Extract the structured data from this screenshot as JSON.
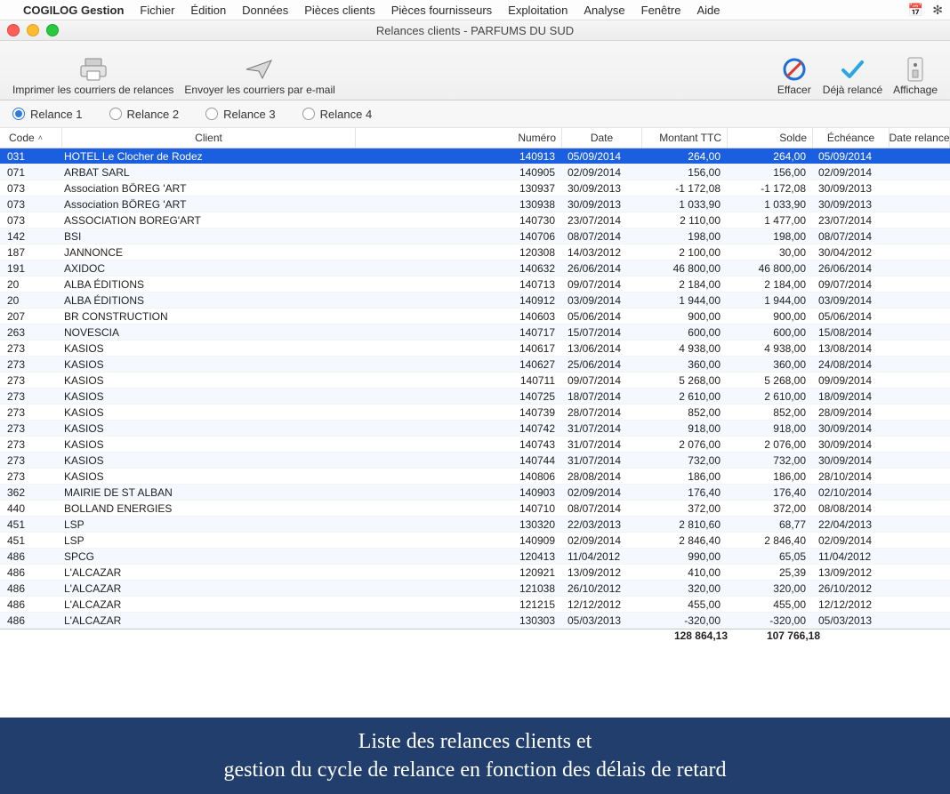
{
  "menubar": {
    "appname": "COGILOG Gestion",
    "items": [
      "Fichier",
      "Édition",
      "Données",
      "Pièces clients",
      "Pièces fournisseurs",
      "Exploitation",
      "Analyse",
      "Fenêtre",
      "Aide"
    ]
  },
  "window": {
    "title": "Relances clients - PARFUMS DU SUD"
  },
  "toolbar": {
    "print": "Imprimer les courriers de relances",
    "email": "Envoyer les courriers par e-mail",
    "clear": "Effacer",
    "done": "Déjà relancé",
    "display": "Affichage"
  },
  "radios": {
    "r1": "Relance 1",
    "r2": "Relance 2",
    "r3": "Relance 3",
    "r4": "Relance 4",
    "selected": 0
  },
  "columns": {
    "code": "Code",
    "client": "Client",
    "numero": "Numéro",
    "date": "Date",
    "montant": "Montant TTC",
    "solde": "Solde",
    "echeance": "Échéance",
    "daterelance": "Date relance"
  },
  "rows": [
    {
      "code": "031",
      "client": "HOTEL Le Clocher de Rodez",
      "num": "140913",
      "date": "05/09/2014",
      "mont": "264,00",
      "sold": "264,00",
      "ech": "05/09/2014",
      "sel": true
    },
    {
      "code": "071",
      "client": "ARBAT SARL",
      "num": "140905",
      "date": "02/09/2014",
      "mont": "156,00",
      "sold": "156,00",
      "ech": "02/09/2014"
    },
    {
      "code": "073",
      "client": "Association BÖREG 'ART",
      "num": "130937",
      "date": "30/09/2013",
      "mont": "-1 172,08",
      "sold": "-1 172,08",
      "ech": "30/09/2013"
    },
    {
      "code": "073",
      "client": "Association BÖREG 'ART",
      "num": "130938",
      "date": "30/09/2013",
      "mont": "1 033,90",
      "sold": "1 033,90",
      "ech": "30/09/2013"
    },
    {
      "code": "073",
      "client": "ASSOCIATION BOREG'ART",
      "num": "140730",
      "date": "23/07/2014",
      "mont": "2 110,00",
      "sold": "1 477,00",
      "ech": "23/07/2014"
    },
    {
      "code": "142",
      "client": "BSI",
      "num": "140706",
      "date": "08/07/2014",
      "mont": "198,00",
      "sold": "198,00",
      "ech": "08/07/2014"
    },
    {
      "code": "187",
      "client": "JANNONCE",
      "num": "120308",
      "date": "14/03/2012",
      "mont": "2 100,00",
      "sold": "30,00",
      "ech": "30/04/2012"
    },
    {
      "code": "191",
      "client": "AXIDOC",
      "num": "140632",
      "date": "26/06/2014",
      "mont": "46 800,00",
      "sold": "46 800,00",
      "ech": "26/06/2014"
    },
    {
      "code": "20",
      "client": "ALBA ÉDITIONS",
      "num": "140713",
      "date": "09/07/2014",
      "mont": "2 184,00",
      "sold": "2 184,00",
      "ech": "09/07/2014"
    },
    {
      "code": "20",
      "client": "ALBA ÉDITIONS",
      "num": "140912",
      "date": "03/09/2014",
      "mont": "1 944,00",
      "sold": "1 944,00",
      "ech": "03/09/2014"
    },
    {
      "code": "207",
      "client": "BR CONSTRUCTION",
      "num": "140603",
      "date": "05/06/2014",
      "mont": "900,00",
      "sold": "900,00",
      "ech": "05/06/2014"
    },
    {
      "code": "263",
      "client": "NOVESCIA",
      "num": "140717",
      "date": "15/07/2014",
      "mont": "600,00",
      "sold": "600,00",
      "ech": "15/08/2014"
    },
    {
      "code": "273",
      "client": "KASIOS",
      "num": "140617",
      "date": "13/06/2014",
      "mont": "4 938,00",
      "sold": "4 938,00",
      "ech": "13/08/2014"
    },
    {
      "code": "273",
      "client": "KASIOS",
      "num": "140627",
      "date": "25/06/2014",
      "mont": "360,00",
      "sold": "360,00",
      "ech": "24/08/2014"
    },
    {
      "code": "273",
      "client": "KASIOS",
      "num": "140711",
      "date": "09/07/2014",
      "mont": "5 268,00",
      "sold": "5 268,00",
      "ech": "09/09/2014"
    },
    {
      "code": "273",
      "client": "KASIOS",
      "num": "140725",
      "date": "18/07/2014",
      "mont": "2 610,00",
      "sold": "2 610,00",
      "ech": "18/09/2014"
    },
    {
      "code": "273",
      "client": "KASIOS",
      "num": "140739",
      "date": "28/07/2014",
      "mont": "852,00",
      "sold": "852,00",
      "ech": "28/09/2014"
    },
    {
      "code": "273",
      "client": "KASIOS",
      "num": "140742",
      "date": "31/07/2014",
      "mont": "918,00",
      "sold": "918,00",
      "ech": "30/09/2014"
    },
    {
      "code": "273",
      "client": "KASIOS",
      "num": "140743",
      "date": "31/07/2014",
      "mont": "2 076,00",
      "sold": "2 076,00",
      "ech": "30/09/2014"
    },
    {
      "code": "273",
      "client": "KASIOS",
      "num": "140744",
      "date": "31/07/2014",
      "mont": "732,00",
      "sold": "732,00",
      "ech": "30/09/2014"
    },
    {
      "code": "273",
      "client": "KASIOS",
      "num": "140806",
      "date": "28/08/2014",
      "mont": "186,00",
      "sold": "186,00",
      "ech": "28/10/2014"
    },
    {
      "code": "362",
      "client": "MAIRIE  DE ST ALBAN",
      "num": "140903",
      "date": "02/09/2014",
      "mont": "176,40",
      "sold": "176,40",
      "ech": "02/10/2014"
    },
    {
      "code": "440",
      "client": "BOLLAND ENERGIES",
      "num": "140710",
      "date": "08/07/2014",
      "mont": "372,00",
      "sold": "372,00",
      "ech": "08/08/2014"
    },
    {
      "code": "451",
      "client": "LSP",
      "num": "130320",
      "date": "22/03/2013",
      "mont": "2 810,60",
      "sold": "68,77",
      "ech": "22/04/2013"
    },
    {
      "code": "451",
      "client": "LSP",
      "num": "140909",
      "date": "02/09/2014",
      "mont": "2 846,40",
      "sold": "2 846,40",
      "ech": "02/09/2014"
    },
    {
      "code": "486",
      "client": "SPCG",
      "num": "120413",
      "date": "11/04/2012",
      "mont": "990,00",
      "sold": "65,05",
      "ech": "11/04/2012"
    },
    {
      "code": "486",
      "client": "L'ALCAZAR",
      "num": "120921",
      "date": "13/09/2012",
      "mont": "410,00",
      "sold": "25,39",
      "ech": "13/09/2012"
    },
    {
      "code": "486",
      "client": "L'ALCAZAR",
      "num": "121038",
      "date": "26/10/2012",
      "mont": "320,00",
      "sold": "320,00",
      "ech": "26/10/2012"
    },
    {
      "code": "486",
      "client": "L'ALCAZAR",
      "num": "121215",
      "date": "12/12/2012",
      "mont": "455,00",
      "sold": "455,00",
      "ech": "12/12/2012"
    },
    {
      "code": "486",
      "client": "L'ALCAZAR",
      "num": "130303",
      "date": "05/03/2013",
      "mont": "-320,00",
      "sold": "-320,00",
      "ech": "05/03/2013"
    }
  ],
  "totals": {
    "montant": "128 864,13",
    "solde": "107 766,18"
  },
  "caption": {
    "line1": "Liste des relances clients et",
    "line2": "gestion du cycle de relance en fonction des délais de retard"
  }
}
